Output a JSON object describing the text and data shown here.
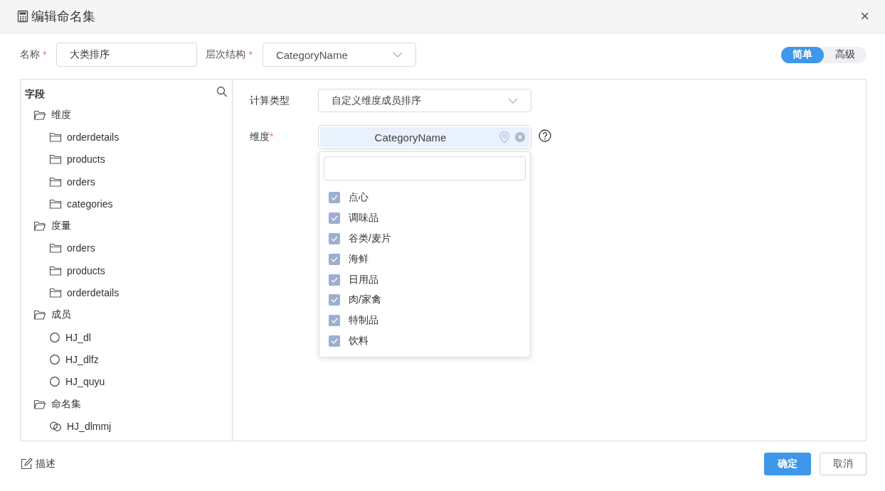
{
  "window": {
    "title": "编辑命名集",
    "close": "×"
  },
  "form": {
    "name_label": "名称",
    "name_required": "*",
    "name_value": "大类排序",
    "hierarchy_label": "层次结构",
    "hierarchy_required": "*",
    "hierarchy_value": "CategoryName"
  },
  "mode_toggle": [
    {
      "label": "简单",
      "selected": true
    },
    {
      "label": "高级",
      "selected": false
    }
  ],
  "field_tree": {
    "title": "字段",
    "groups": [
      {
        "label": "维度",
        "expanded": true,
        "children": [
          {
            "label": "orderdetails",
            "kind": "folder"
          },
          {
            "label": "products",
            "kind": "folder"
          },
          {
            "label": "orders",
            "kind": "folder"
          },
          {
            "label": "categories",
            "kind": "folder"
          }
        ]
      },
      {
        "label": "度量",
        "expanded": true,
        "children": [
          {
            "label": "orders",
            "kind": "folder"
          },
          {
            "label": "products",
            "kind": "folder"
          },
          {
            "label": "orderdetails",
            "kind": "folder"
          }
        ]
      },
      {
        "label": "成员",
        "expanded": true,
        "children": [
          {
            "label": "HJ_dl",
            "kind": "member"
          },
          {
            "label": "HJ_dlfz",
            "kind": "member"
          },
          {
            "label": "HJ_quyu",
            "kind": "member"
          }
        ]
      },
      {
        "label": "命名集",
        "expanded": true,
        "children": [
          {
            "label": "HJ_dlmmj",
            "kind": "namedset"
          }
        ]
      }
    ]
  },
  "settings": {
    "calc_type_label": "计算类型",
    "calc_type_value": "自定义维度成员排序",
    "dimension_label": "维度",
    "dimension_required": "*",
    "dimension_tag": "CategoryName"
  },
  "member_dropdown": {
    "items": [
      {
        "label": "点心",
        "checked": true
      },
      {
        "label": "调味品",
        "checked": true
      },
      {
        "label": "谷类/麦片",
        "checked": true
      },
      {
        "label": "海鲜",
        "checked": true
      },
      {
        "label": "日用品",
        "checked": true
      },
      {
        "label": "肉/家禽",
        "checked": true
      },
      {
        "label": "特制品",
        "checked": true
      },
      {
        "label": "饮料",
        "checked": true
      }
    ]
  },
  "footer": {
    "description_link": "描述",
    "buttons": [
      {
        "label": "确定",
        "kind": "primary"
      },
      {
        "label": "取消",
        "kind": "secondary"
      }
    ]
  }
}
